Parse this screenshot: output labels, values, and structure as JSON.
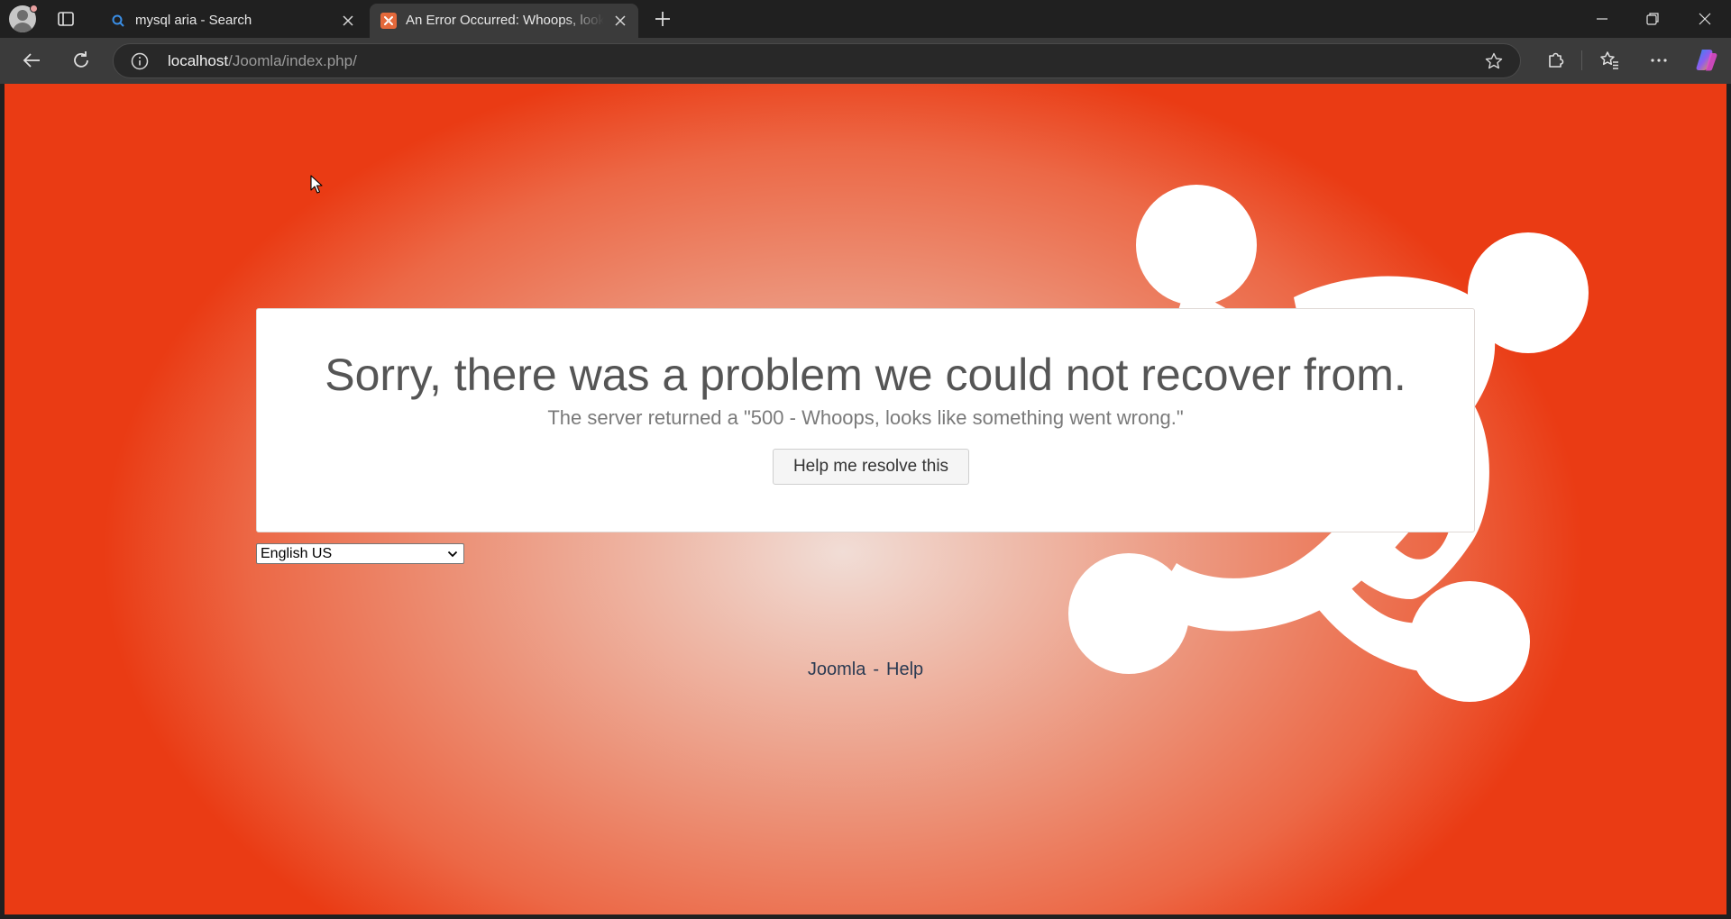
{
  "browser": {
    "tabs": [
      {
        "title": "mysql aria - Search",
        "favicon": "search-icon"
      },
      {
        "title": "An Error Occurred: Whoops, looks like something went wrong.",
        "favicon": "joomla-icon"
      }
    ],
    "url_host": "localhost",
    "url_path": "/Joomla/index.php/"
  },
  "page": {
    "heading": "Sorry, there was a problem we could not recover from.",
    "message": "The server returned a \"500 - Whoops, looks like something went wrong.\"",
    "help_button": "Help me resolve this",
    "language_selected": "English US",
    "footer_links": [
      "Joomla",
      "Help"
    ],
    "footer_separator": "-"
  },
  "colors": {
    "background_edge": "#ea3b14",
    "background_center": "#f1ddd6",
    "card": "#ffffff"
  }
}
